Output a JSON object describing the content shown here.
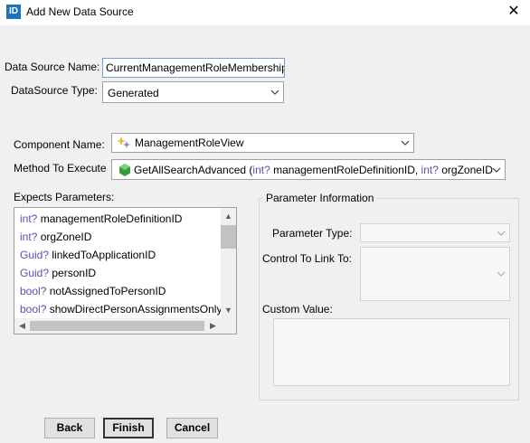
{
  "window": {
    "icon_text": "ID",
    "title": "Add New Data Source",
    "close_glyph": "✕"
  },
  "form": {
    "data_source_name_label": "Data Source Name:",
    "data_source_name_value": "CurrentManagementRoleMembershipA",
    "data_source_type_label": "DataSource Type:",
    "data_source_type_value": "Generated",
    "component_name_label": "Component Name:",
    "component_name_value": "ManagementRoleView",
    "method_label": "Method To Execute",
    "method_value": {
      "name": "GetAllSearchAdvanced",
      "open_paren": " (",
      "type1": "int?",
      "param1": " managementRoleDefinitionID, ",
      "type2": "int?",
      "param2": " orgZoneID"
    }
  },
  "parameters": {
    "label": "Expects Parameters:",
    "items": [
      {
        "type": "int?",
        "name": "managementRoleDefinitionID"
      },
      {
        "type": "int?",
        "name": "orgZoneID"
      },
      {
        "type": "Guid?",
        "name": "linkedToApplicationID"
      },
      {
        "type": "Guid?",
        "name": "personID"
      },
      {
        "type": "bool?",
        "name": "notAssignedToPersonID"
      },
      {
        "type": "bool?",
        "name": "showDirectPersonAssignmentsOnly"
      }
    ]
  },
  "parameter_info": {
    "group_title": "Parameter Information",
    "type_label": "Parameter Type:",
    "control_label": "Control To Link To:",
    "custom_value_label": "Custom Value:"
  },
  "buttons": {
    "back": "Back",
    "finish": "Finish",
    "cancel": "Cancel"
  },
  "icons": {
    "component": "component-sparkle-icon",
    "method": "green-method-cube-icon"
  }
}
